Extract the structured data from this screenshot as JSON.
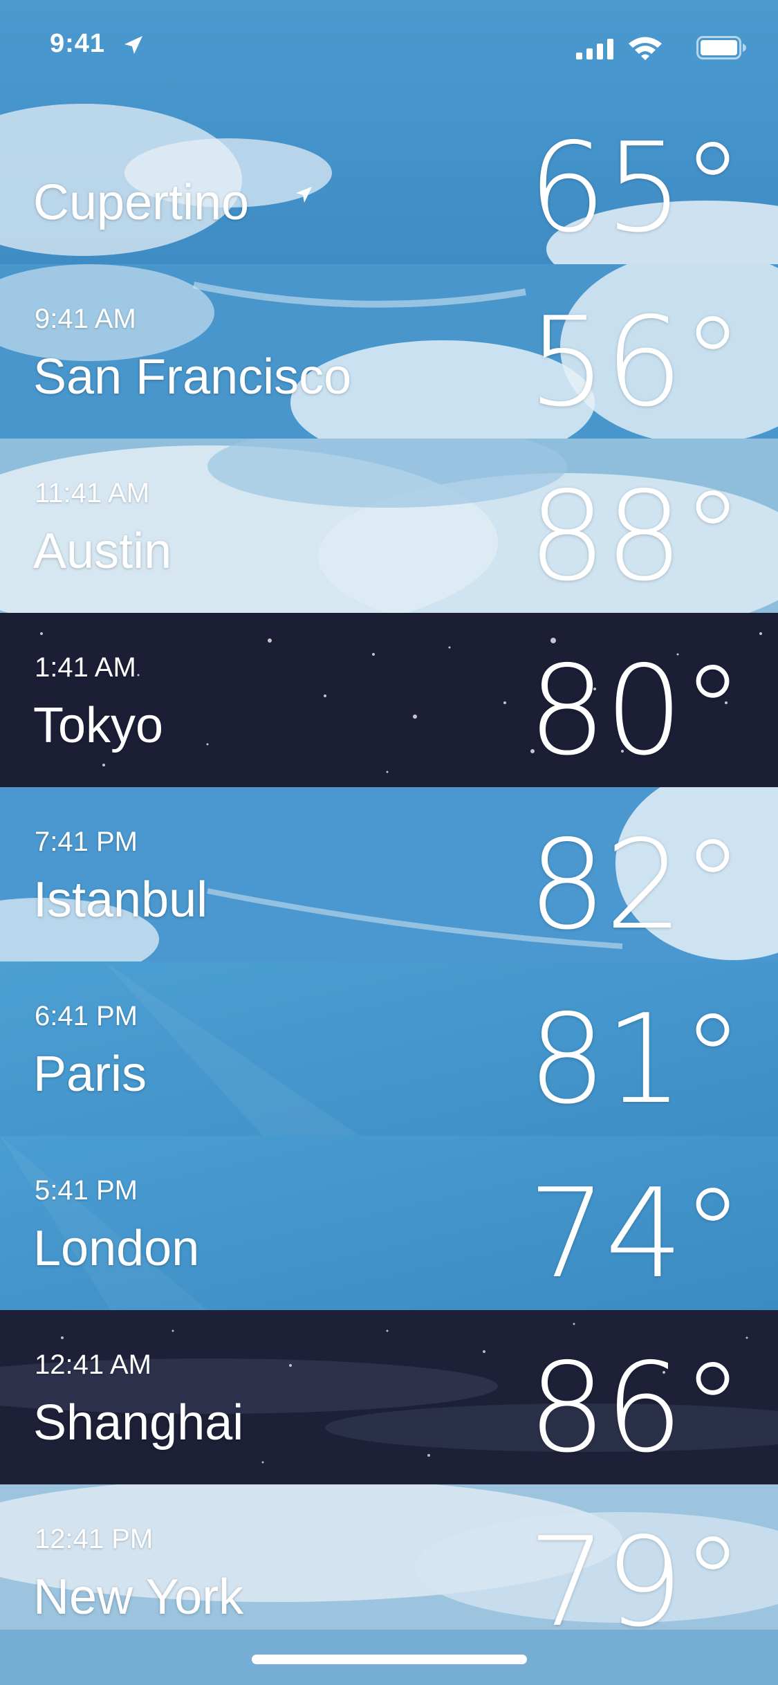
{
  "status_bar": {
    "time": "9:41",
    "location_icon": "location-arrow-icon",
    "signal_icon": "cellular-signal-icon",
    "wifi_icon": "wifi-icon",
    "battery_icon": "battery-icon"
  },
  "cities": [
    {
      "time": "",
      "name": "Cupertino",
      "temp": "65°",
      "current_location": true,
      "theme": "day"
    },
    {
      "time": "9:41 AM",
      "name": "San Francisco",
      "temp": "56°",
      "theme": "day"
    },
    {
      "time": "11:41 AM",
      "name": "Austin",
      "temp": "88°",
      "theme": "day"
    },
    {
      "time": "1:41 AM",
      "name": "Tokyo",
      "temp": "80°",
      "theme": "night"
    },
    {
      "time": "7:41 PM",
      "name": "Istanbul",
      "temp": "82°",
      "theme": "day"
    },
    {
      "time": "6:41 PM",
      "name": "Paris",
      "temp": "81°",
      "theme": "day"
    },
    {
      "time": "5:41 PM",
      "name": "London",
      "temp": "74°",
      "theme": "day"
    },
    {
      "time": "12:41 AM",
      "name": "Shanghai",
      "temp": "86°",
      "theme": "night"
    },
    {
      "time": "12:41 PM",
      "name": "New York",
      "temp": "79°",
      "theme": "day"
    }
  ],
  "colors": {
    "day_sky": "#3f8fc4",
    "night_sky": "#1c1e36",
    "text": "#ffffff"
  }
}
